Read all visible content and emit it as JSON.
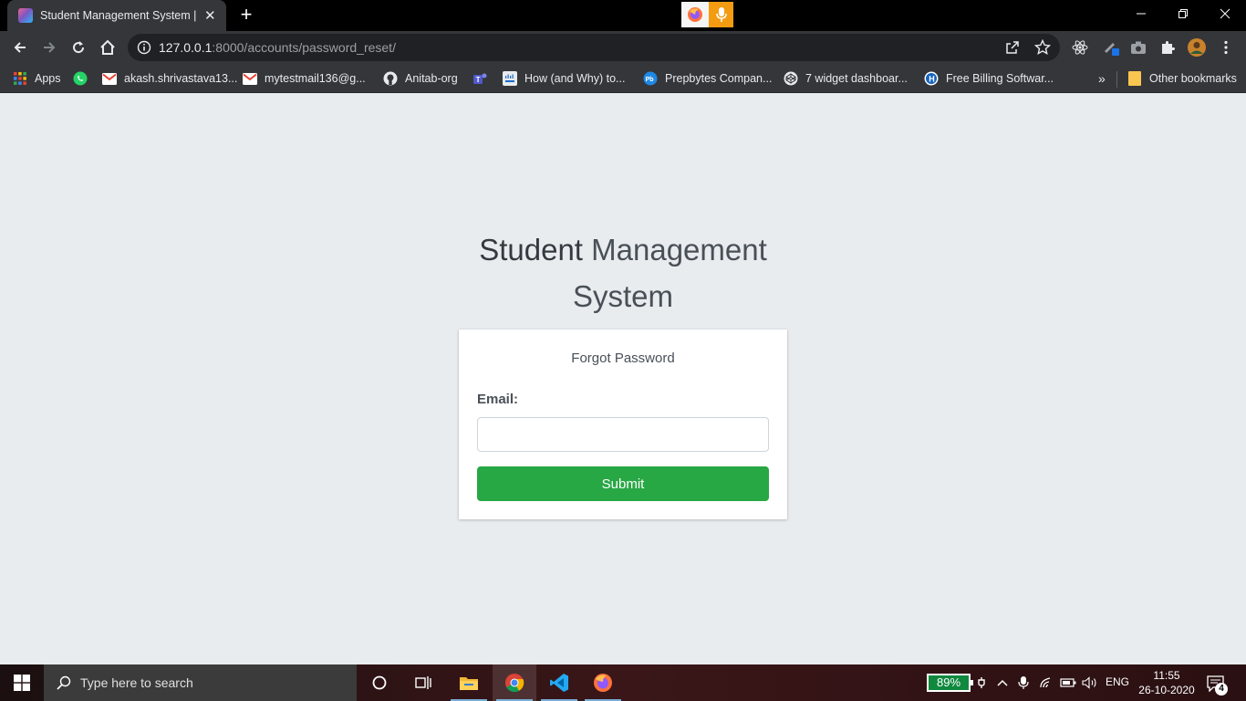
{
  "browser": {
    "tab_title": "Student Management System | Lo",
    "url_host": "127.0.0.1",
    "url_path": ":8000/accounts/password_reset/"
  },
  "bookmarks": [
    {
      "label": "Apps",
      "icon": "apps-grid-icon"
    },
    {
      "label": "",
      "icon": "whatsapp-icon"
    },
    {
      "label": "akash.shrivastava13...",
      "icon": "gmail-icon"
    },
    {
      "label": "mytestmail136@g...",
      "icon": "gmail-icon"
    },
    {
      "label": "Anitab-org",
      "icon": "github-icon"
    },
    {
      "label": "",
      "icon": "teams-icon"
    },
    {
      "label": "How (and Why) to...",
      "icon": "cisco-icon"
    },
    {
      "label": "Prepbytes Compan...",
      "icon": "prepbytes-icon"
    },
    {
      "label": "7 widget dashboar...",
      "icon": "codepen-icon"
    },
    {
      "label": "Free Billing Softwar...",
      "icon": "billing-icon"
    }
  ],
  "bookmarks_overflow": "»",
  "other_bookmarks": "Other bookmarks",
  "page": {
    "title_bold": "Student",
    "title_rest": " Management System",
    "card_message": "Forgot Password",
    "email_label": "Email:",
    "email_value": "",
    "submit_label": "Submit"
  },
  "taskbar": {
    "search_placeholder": "Type here to search",
    "battery": "89%",
    "language": "ENG",
    "time": "11:55",
    "date": "26-10-2020",
    "notification_count": "4"
  },
  "colors": {
    "page_background": "#e9ecef",
    "submit_button": "#28a745",
    "browser_chrome": "#35363a"
  }
}
